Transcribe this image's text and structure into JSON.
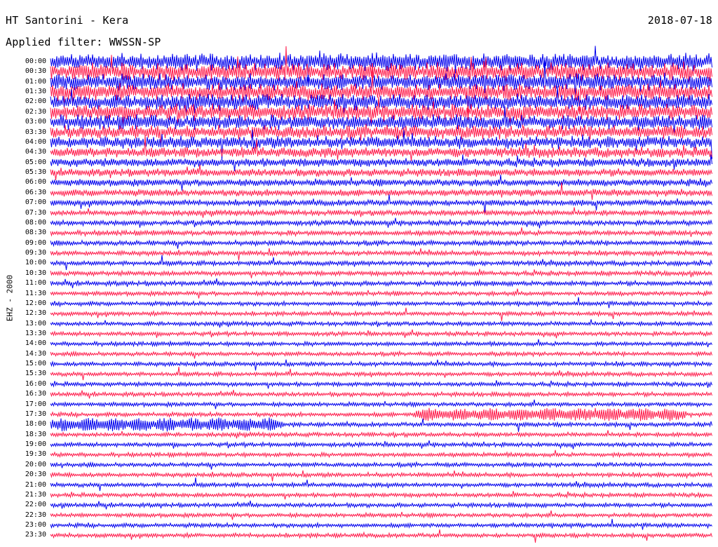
{
  "header": {
    "title": "HT Santorini - Kera",
    "date": "2018-07-18",
    "filter": "Applied filter: WWSSN-SP",
    "channel_label": "EHZ - 2000"
  },
  "colors": {
    "trace_a": "#0000ee",
    "trace_b": "#ff1a4a",
    "background": "#ffffff",
    "text": "#000000"
  },
  "chart_data": {
    "type": "helicorder",
    "title": "HT Santorini - Kera",
    "subtitle": "Applied filter: WWSSN-SP",
    "date": "2018-07-18",
    "ylabel": "EHZ - 2000",
    "row_labels": [
      "00:00",
      "00:30",
      "01:00",
      "01:30",
      "02:00",
      "02:30",
      "03:00",
      "03:30",
      "04:00",
      "04:30",
      "05:00",
      "05:30",
      "06:00",
      "06:30",
      "07:00",
      "07:30",
      "08:00",
      "08:30",
      "09:00",
      "09:30",
      "10:00",
      "10:30",
      "11:00",
      "11:30",
      "12:00",
      "12:30",
      "13:00",
      "13:30",
      "14:00",
      "14:30",
      "15:00",
      "15:30",
      "16:00",
      "16:30",
      "17:00",
      "17:30",
      "18:00",
      "18:30",
      "19:00",
      "19:30",
      "20:00",
      "20:30",
      "21:00",
      "21:30",
      "22:00",
      "22:30",
      "23:00",
      "23:30"
    ],
    "row_colors": [
      "trace_a",
      "trace_b"
    ],
    "row_noise_level": [
      1.0,
      1.0,
      0.95,
      0.95,
      0.9,
      0.9,
      0.85,
      0.8,
      0.7,
      0.6,
      0.5,
      0.45,
      0.42,
      0.4,
      0.35,
      0.32,
      0.3,
      0.3,
      0.3,
      0.28,
      0.28,
      0.28,
      0.28,
      0.26,
      0.25,
      0.25,
      0.25,
      0.25,
      0.25,
      0.25,
      0.25,
      0.25,
      0.25,
      0.25,
      0.25,
      0.25,
      0.25,
      0.25,
      0.25,
      0.25,
      0.25,
      0.25,
      0.25,
      0.25,
      0.25,
      0.25,
      0.25,
      0.25
    ],
    "events": [
      {
        "row": "17:30",
        "start": 0.55,
        "end": 0.96,
        "amplitude": 0.9
      },
      {
        "row": "18:00",
        "start": 0.0,
        "end": 0.35,
        "amplitude": 0.95
      }
    ],
    "grid": false,
    "legend": "none"
  }
}
